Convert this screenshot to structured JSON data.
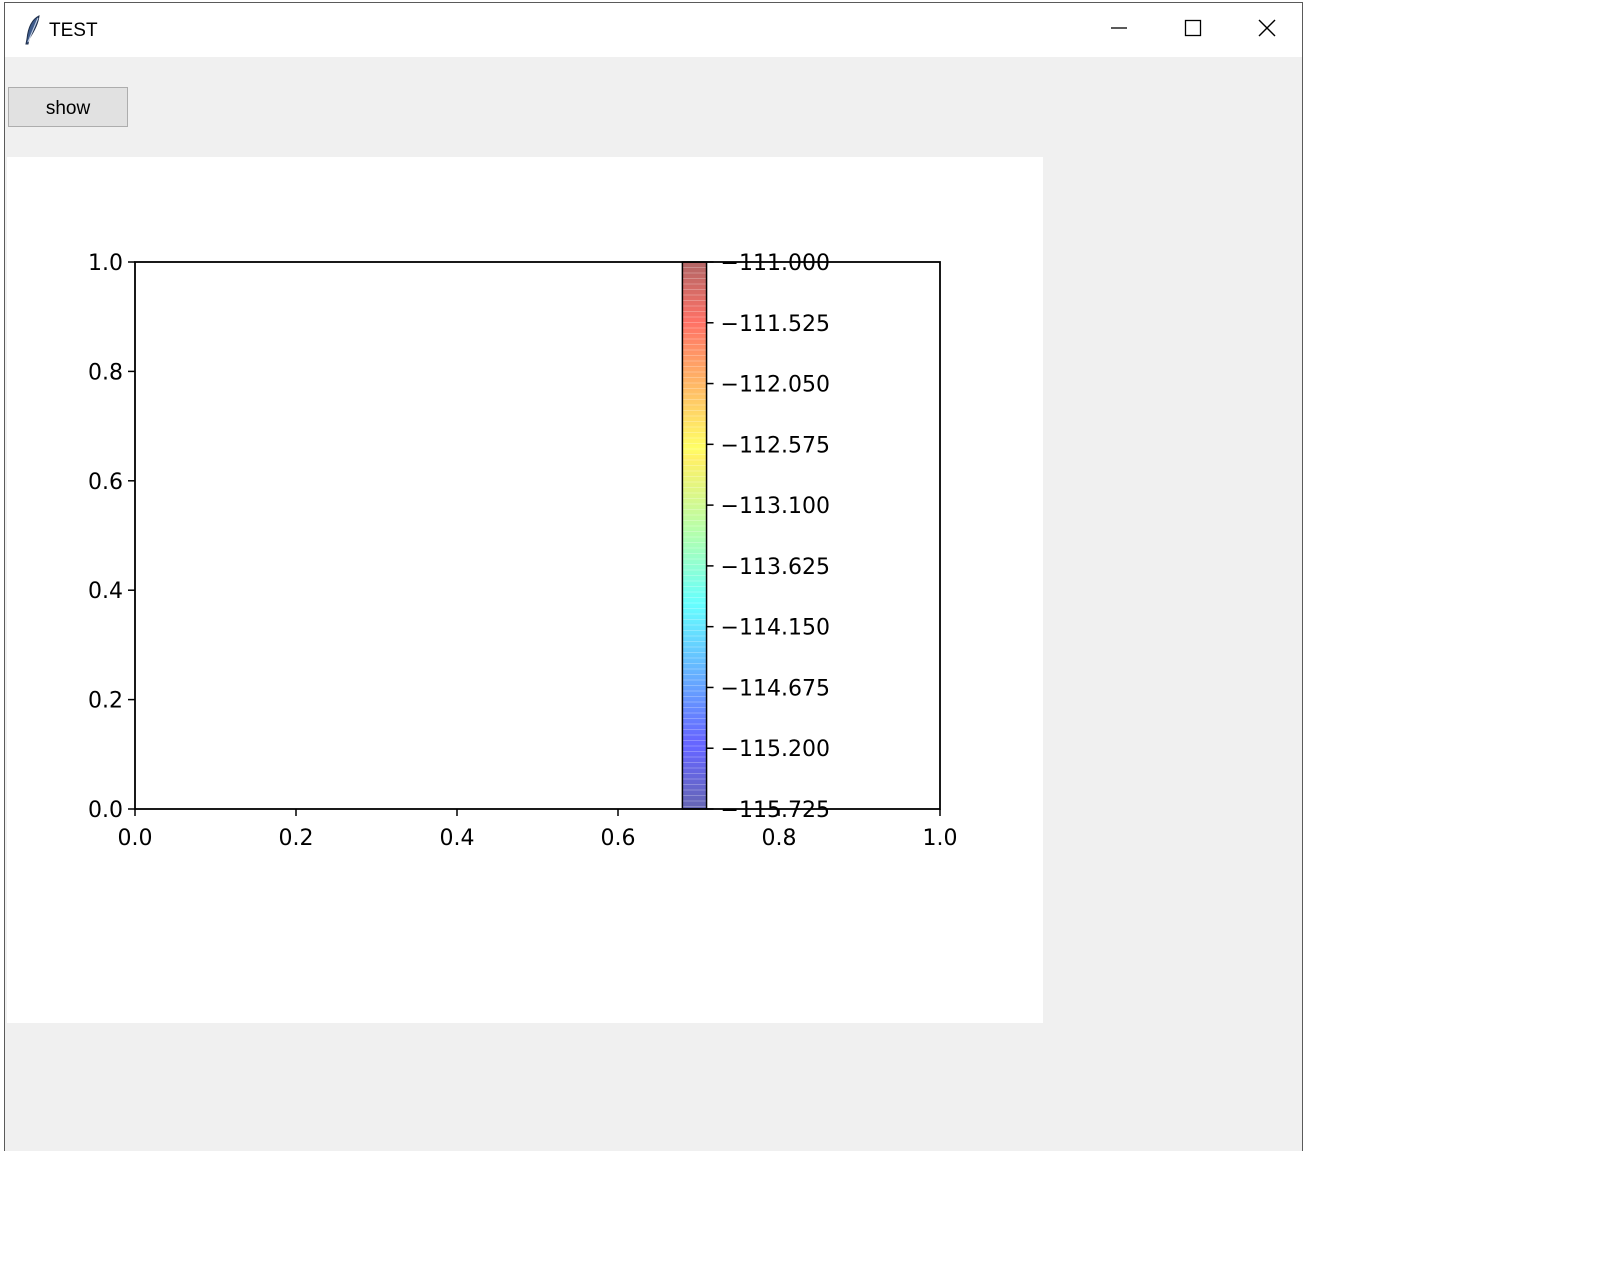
{
  "window": {
    "title": "TEST",
    "icon": "feather-icon",
    "controls": {
      "minimize": "minimize-icon",
      "maximize": "maximize-icon",
      "close": "close-icon"
    }
  },
  "toolbar": {
    "show_label": "show"
  },
  "chart_data": {
    "type": "colorbar",
    "title": "",
    "xlabel": "",
    "ylabel": "",
    "xlim": [
      0.0,
      1.0
    ],
    "ylim": [
      0.0,
      1.0
    ],
    "x_ticks": [
      "0.0",
      "0.2",
      "0.4",
      "0.6",
      "0.8",
      "1.0"
    ],
    "y_ticks": [
      "0.0",
      "0.2",
      "0.4",
      "0.6",
      "0.8",
      "1.0"
    ],
    "colorbar": {
      "colormap": "jet",
      "alpha": 0.6,
      "range": [
        -115.725,
        -111.0
      ],
      "ticks": [
        -111.0,
        -111.525,
        -112.05,
        -112.575,
        -113.1,
        -113.625,
        -114.15,
        -114.675,
        -115.2,
        -115.725
      ],
      "tick_labels": [
        "−111.000",
        "−111.525",
        "−112.050",
        "−112.575",
        "−113.100",
        "−113.625",
        "−114.150",
        "−114.675",
        "−115.200",
        "−115.725"
      ],
      "x_range": [
        0.68,
        0.71
      ]
    },
    "grid": false
  }
}
